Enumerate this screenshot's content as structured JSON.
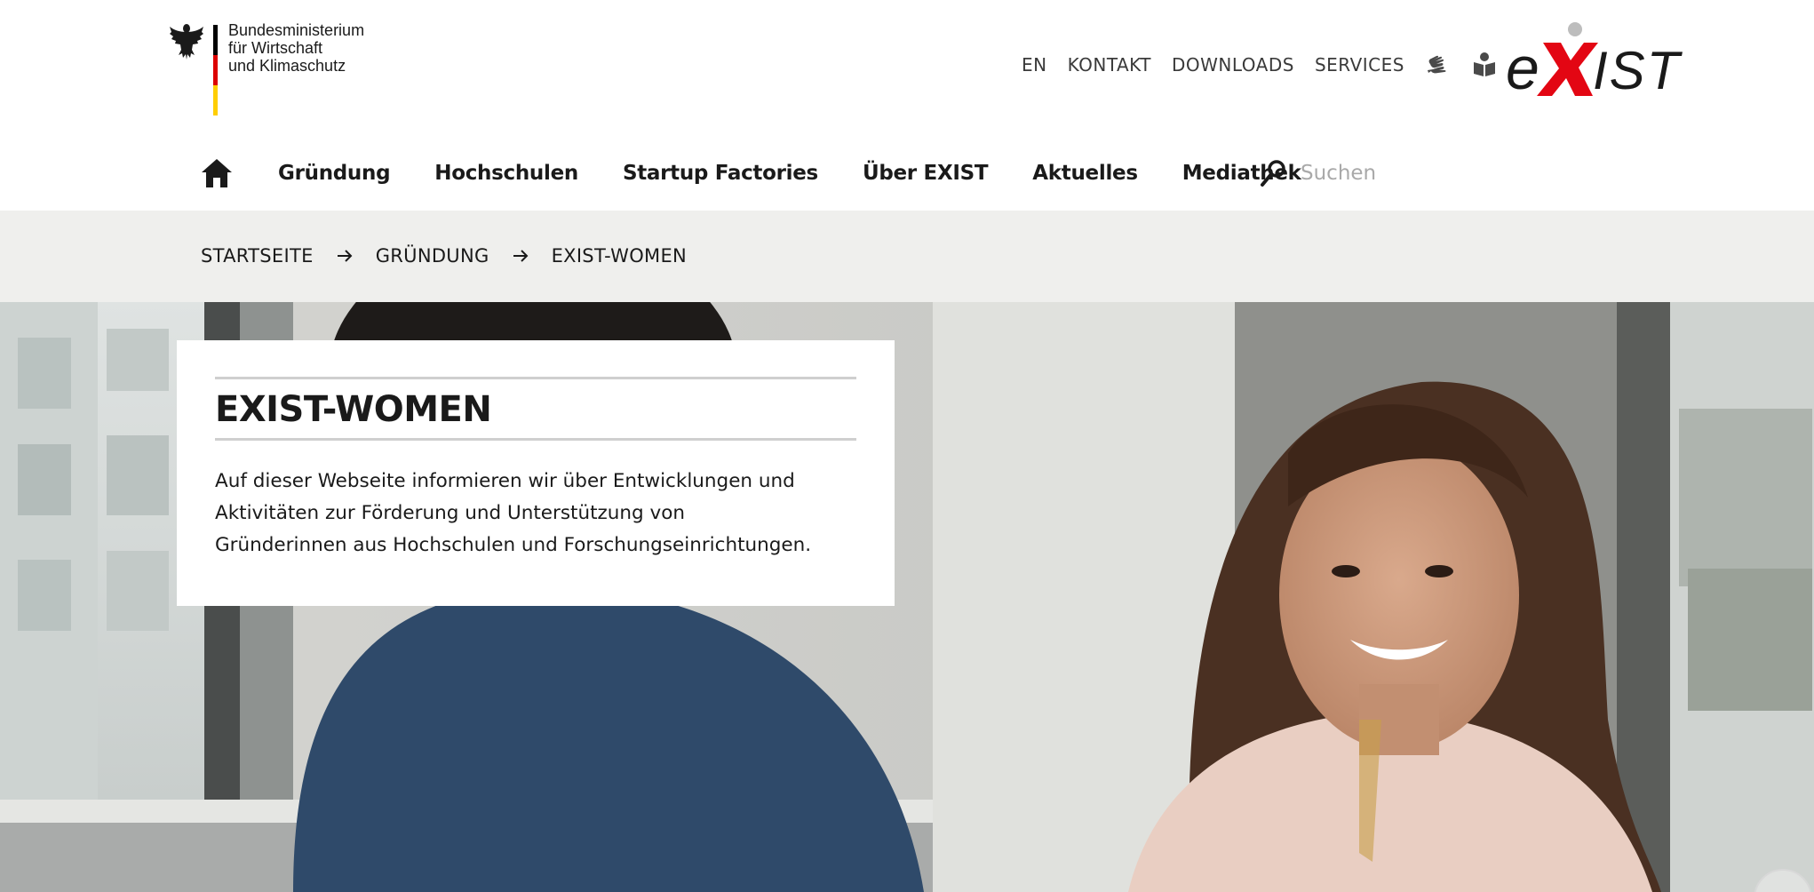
{
  "ministry_logo": {
    "lines": [
      "Bundesministerium",
      "für Wirtschaft",
      "und Klimaschutz"
    ],
    "flag_colors": [
      "#000000",
      "#dd0000",
      "#ffce00"
    ]
  },
  "meta_nav": {
    "items": [
      "EN",
      "KONTAKT",
      "DOWNLOADS",
      "SERVICES"
    ],
    "icons": [
      "sign-language-icon",
      "easy-read-icon"
    ]
  },
  "exist_logo": {
    "text": "eXIST",
    "colors": {
      "x": "#e30613",
      "letters": "#1a1a1a",
      "dot": "#bdbdbd"
    }
  },
  "main_nav": {
    "home_icon": "home-icon",
    "items": [
      "Gründung",
      "Hochschulen",
      "Startup Factories",
      "Über EXIST",
      "Aktuelles",
      "Mediathek"
    ]
  },
  "search": {
    "placeholder": "Suchen",
    "icon": "search-icon"
  },
  "breadcrumb": {
    "items": [
      "STARTSEITE",
      "GRÜNDUNG",
      "EXIST-WOMEN"
    ],
    "separator_icon": "arrow-right-icon"
  },
  "hero": {
    "title": "EXIST-WOMEN",
    "text_lines": [
      "Auf dieser Webseite informieren wir über Entwicklungen und",
      "Aktivitäten zur Förderung und Unterstützung von",
      "Gründerinnen aus Hochschulen und Forschungseinrichtungen."
    ]
  },
  "colors": {
    "accent_red": "#e30613",
    "breadcrumb_bg": "#efefed",
    "text": "#1a1a1a",
    "rule": "#cfcfcf"
  }
}
